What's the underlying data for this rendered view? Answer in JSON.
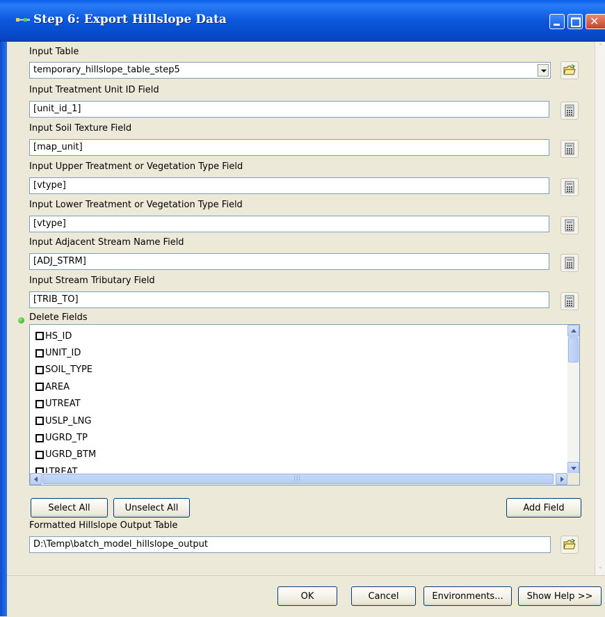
{
  "window": {
    "title": "Step 6: Export Hillslope Data"
  },
  "fields": {
    "input_table": {
      "label": "Input Table",
      "value": "temporary_hillslope_table_step5"
    },
    "unit_id": {
      "label": "Input Treatment Unit ID Field",
      "value": "[unit_id_1]"
    },
    "soil_texture": {
      "label": "Input Soil Texture Field",
      "value": "[map_unit]"
    },
    "upper_veg": {
      "label": "Input Upper Treatment or Vegetation Type Field",
      "value": "[vtype]"
    },
    "lower_veg": {
      "label": "Input Lower Treatment or Vegetation Type Field",
      "value": "[vtype]"
    },
    "adj_stream": {
      "label": "Input Adjacent Stream Name Field",
      "value": "[ADJ_STRM]"
    },
    "trib": {
      "label": "Input Stream Tributary Field",
      "value": "[TRIB_TO]"
    },
    "output_table": {
      "label": "Formatted Hillslope Output Table",
      "value": "D:\\Temp\\batch_model_hillslope_output"
    }
  },
  "delete_fields": {
    "label": "Delete Fields",
    "items": [
      "HS_ID",
      "UNIT_ID",
      "SOIL_TYPE",
      "AREA",
      "UTREAT",
      "USLP_LNG",
      "UGRD_TP",
      "UGRD_BTM",
      "LTREAT"
    ]
  },
  "buttons": {
    "select_all": "Select All",
    "unselect_all": "Unselect All",
    "add_field": "Add Field",
    "ok": "OK",
    "cancel": "Cancel",
    "environments": "Environments...",
    "show_help": "Show Help >>"
  },
  "colors": {
    "title_bar": "#0b57dc",
    "required_dot": "#1d9b1d",
    "field_border": "#7f9db9"
  }
}
